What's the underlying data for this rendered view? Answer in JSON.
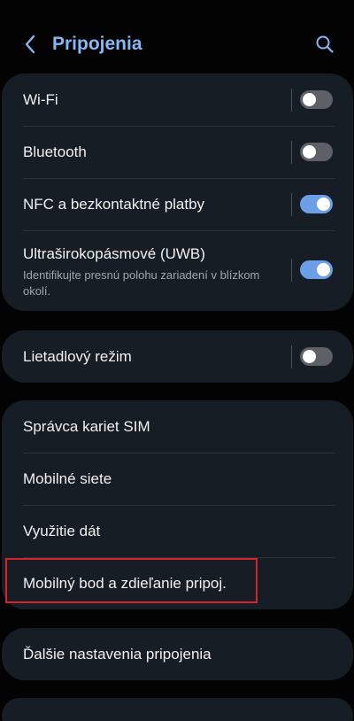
{
  "header": {
    "title": "Pripojenia",
    "back_icon": "chevron-left-icon",
    "search_icon": "search-icon"
  },
  "colors": {
    "background": "#030303",
    "card": "#171d25",
    "title_accent": "#85b8f4",
    "toggle_on": "#6c9fe7",
    "toggle_off": "#5d6167",
    "highlight": "#d8232a"
  },
  "group1": {
    "items": [
      {
        "label": "Wi-Fi",
        "toggle": "off"
      },
      {
        "label": "Bluetooth",
        "toggle": "off"
      },
      {
        "label": "NFC a bezkontaktné platby",
        "toggle": "on"
      },
      {
        "label": "Ultraširokopásmové (UWB)",
        "subtitle": "Identifikujte presnú polohu zariadení v blízkom okolí.",
        "toggle": "on"
      }
    ]
  },
  "group2": {
    "items": [
      {
        "label": "Lietadlový režim",
        "toggle": "off"
      }
    ]
  },
  "group3": {
    "items": [
      {
        "label": "Správca kariet SIM"
      },
      {
        "label": "Mobilné siete"
      },
      {
        "label": "Využitie dát"
      },
      {
        "label": "Mobilný bod a zdieľanie pripoj.",
        "highlighted": true
      }
    ]
  },
  "group4": {
    "items": [
      {
        "label": "Ďalšie nastavenia pripojenia"
      }
    ]
  }
}
